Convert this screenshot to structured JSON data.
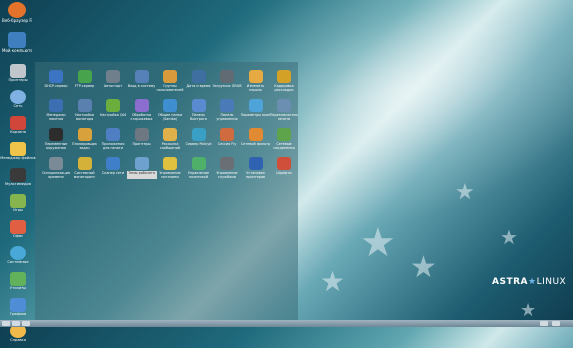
{
  "desktop": {
    "icons": [
      {
        "label": "Веб-браузер Firefox",
        "color": "#e3722a",
        "icon": "firefox-icon"
      },
      {
        "label": "Мой компьютер",
        "color": "#3f7fbf",
        "icon": "computer-icon"
      }
    ]
  },
  "launcher": {
    "items": [
      {
        "label": "Принтеры",
        "color": "#c0c6cc",
        "icon": "printer-icon"
      },
      {
        "label": "Сеть",
        "color": "#7fb1e3",
        "icon": "network-icon"
      },
      {
        "label": "Корзина",
        "color": "#d0463a",
        "icon": "trash-icon"
      },
      {
        "label": "Менеджер файлов",
        "color": "#f0c34a",
        "icon": "folder-icon"
      },
      {
        "label": "Мультимедиа",
        "color": "#3a3a3a",
        "icon": "clapper-icon"
      },
      {
        "label": "Игры",
        "color": "#86b44f",
        "icon": "gamepad-icon"
      },
      {
        "label": "Офис",
        "color": "#e05f43",
        "icon": "pen-icon"
      },
      {
        "label": "Системные",
        "color": "#4aa8d8",
        "icon": "gear-icon"
      },
      {
        "label": "Утилиты",
        "color": "#62b25c",
        "icon": "tools-icon"
      },
      {
        "label": "Графика",
        "color": "#4f8dd6",
        "icon": "brush-icon"
      },
      {
        "label": "Справка",
        "color": "#f1b84a",
        "icon": "help-icon"
      }
    ]
  },
  "panel": {
    "rows": [
      [
        {
          "label": "DHCP-сервер",
          "color": "#3b74c2"
        },
        {
          "label": "FTP-сервер",
          "color": "#47a44d"
        },
        {
          "label": "Автостарт",
          "color": "#6f7f8b"
        },
        {
          "label": "Вход в систему",
          "color": "#5580b8"
        },
        {
          "label": "Группы пользователей",
          "color": "#d99a3b"
        },
        {
          "label": "Дата и время",
          "color": "#3f6fa0"
        },
        {
          "label": "Загрузчик GRUB",
          "color": "#616b74"
        },
        {
          "label": "Изменить пароль",
          "color": "#e7a942"
        },
        {
          "label": "Кодировка раскладки",
          "color": "#d3a126"
        }
      ],
      [
        {
          "label": "Менеджер пакетов",
          "color": "#3b6fb1"
        },
        {
          "label": "Настройка монитора",
          "color": "#5a80b0"
        },
        {
          "label": "Настройка Qt4",
          "color": "#6cae3e"
        },
        {
          "label": "Обработка сторожевых",
          "color": "#8b6ccf"
        },
        {
          "label": "Общие папки (Samba)",
          "color": "#3f8fd0"
        },
        {
          "label": "Панель быстрого",
          "color": "#5a8ad0"
        },
        {
          "label": "Панель управления",
          "color": "#4b7ab8"
        },
        {
          "label": "Параметры окон",
          "color": "#4ea3d9"
        },
        {
          "label": "Переключатель печати",
          "color": "#6b8fb0"
        }
      ],
      [
        {
          "label": "Переменные окружения",
          "color": "#2c2c2c"
        },
        {
          "label": "Планировщик задач",
          "color": "#d9a13b"
        },
        {
          "label": "Приложения для печати",
          "color": "#4f7fc2"
        },
        {
          "label": "Принтеры",
          "color": "#6d7882"
        },
        {
          "label": "Рассылка сообщений",
          "color": "#e0b14a"
        },
        {
          "label": "Сервер Policyd",
          "color": "#3a9fc4"
        },
        {
          "label": "Сессия Fly",
          "color": "#cf6b3e"
        },
        {
          "label": "Сетевой фильтр",
          "color": "#e08b34"
        },
        {
          "label": "Сетевые соединения",
          "color": "#5ea44a"
        }
      ],
      [
        {
          "label": "Синхронизация времени",
          "color": "#7a8a96"
        },
        {
          "label": "Системный мониторинг",
          "color": "#d4b23a"
        },
        {
          "label": "Сканер сети",
          "color": "#3f7ec8"
        },
        {
          "label": "Темы рабочего",
          "color": "#6fa1cf",
          "selected": true
        },
        {
          "label": "Управление питанием",
          "color": "#e0c13f"
        },
        {
          "label": "Управление политикой",
          "color": "#4fb06a"
        },
        {
          "label": "Управление службами",
          "color": "#6a6f75"
        },
        {
          "label": "Установка принтеров",
          "color": "#2f62b0"
        },
        {
          "label": "Шрифты",
          "color": "#cf4f3a"
        }
      ]
    ]
  },
  "branding": {
    "logo_main": "ASTRA",
    "logo_sub": "LINUX"
  }
}
